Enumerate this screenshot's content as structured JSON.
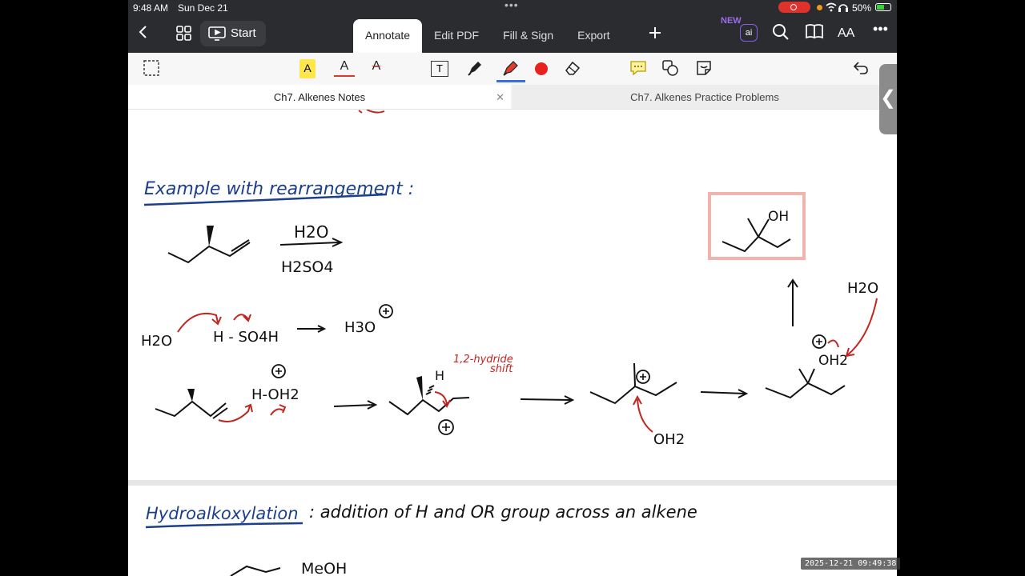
{
  "status": {
    "time": "9:48 AM",
    "date": "Sun Dec 21",
    "battery": "50%"
  },
  "toolbar": {
    "start_label": "Start",
    "tabs": [
      "Annotate",
      "Edit PDF",
      "Fill & Sign",
      "Export"
    ],
    "new_badge": "NEW",
    "ai_label": "ai",
    "font_size_label": "AA"
  },
  "annot_tools": {
    "highlight_letter": "A",
    "text_color_letter": "A",
    "strike_letter": "A",
    "textbox_letter": "T"
  },
  "doc_tabs": [
    {
      "label": "Ch7. Alkenes Notes",
      "active": true
    },
    {
      "label": "Ch7. Alkenes Practice Problems",
      "active": false
    }
  ],
  "notes": {
    "heading_rearrangement": "Example with rearrangement :",
    "reagent_top": "H2O",
    "reagent_bottom": "H2SO4",
    "water": "H2O",
    "acid": "H - SO4H",
    "hydronium": "H3O",
    "h_oh2": "H-OH2",
    "hydride_shift_line1": "1,2-hydride",
    "hydride_shift_line2": "shift",
    "h_label": "H",
    "oh2_bottom": "OH2",
    "oh2_right": "OH2",
    "h2o_right": "H2O",
    "product_oh": "OH",
    "heading_hydroalkoxylation": "Hydroalkoxylation",
    "hydroalkoxylation_text": ": addition of   H   and    OR  group across an alkene",
    "meoh": "MeOH"
  },
  "colors": {
    "ink_blue": "#1c3f8c",
    "ink_red": "#c0261f",
    "ink_black": "#111111",
    "box_pink": "#f2b3ac",
    "toolbar_dark": "#2b2c2f",
    "accent_blue": "#3b6fd9"
  },
  "timestamp": "2025-12-21  09:49:38"
}
